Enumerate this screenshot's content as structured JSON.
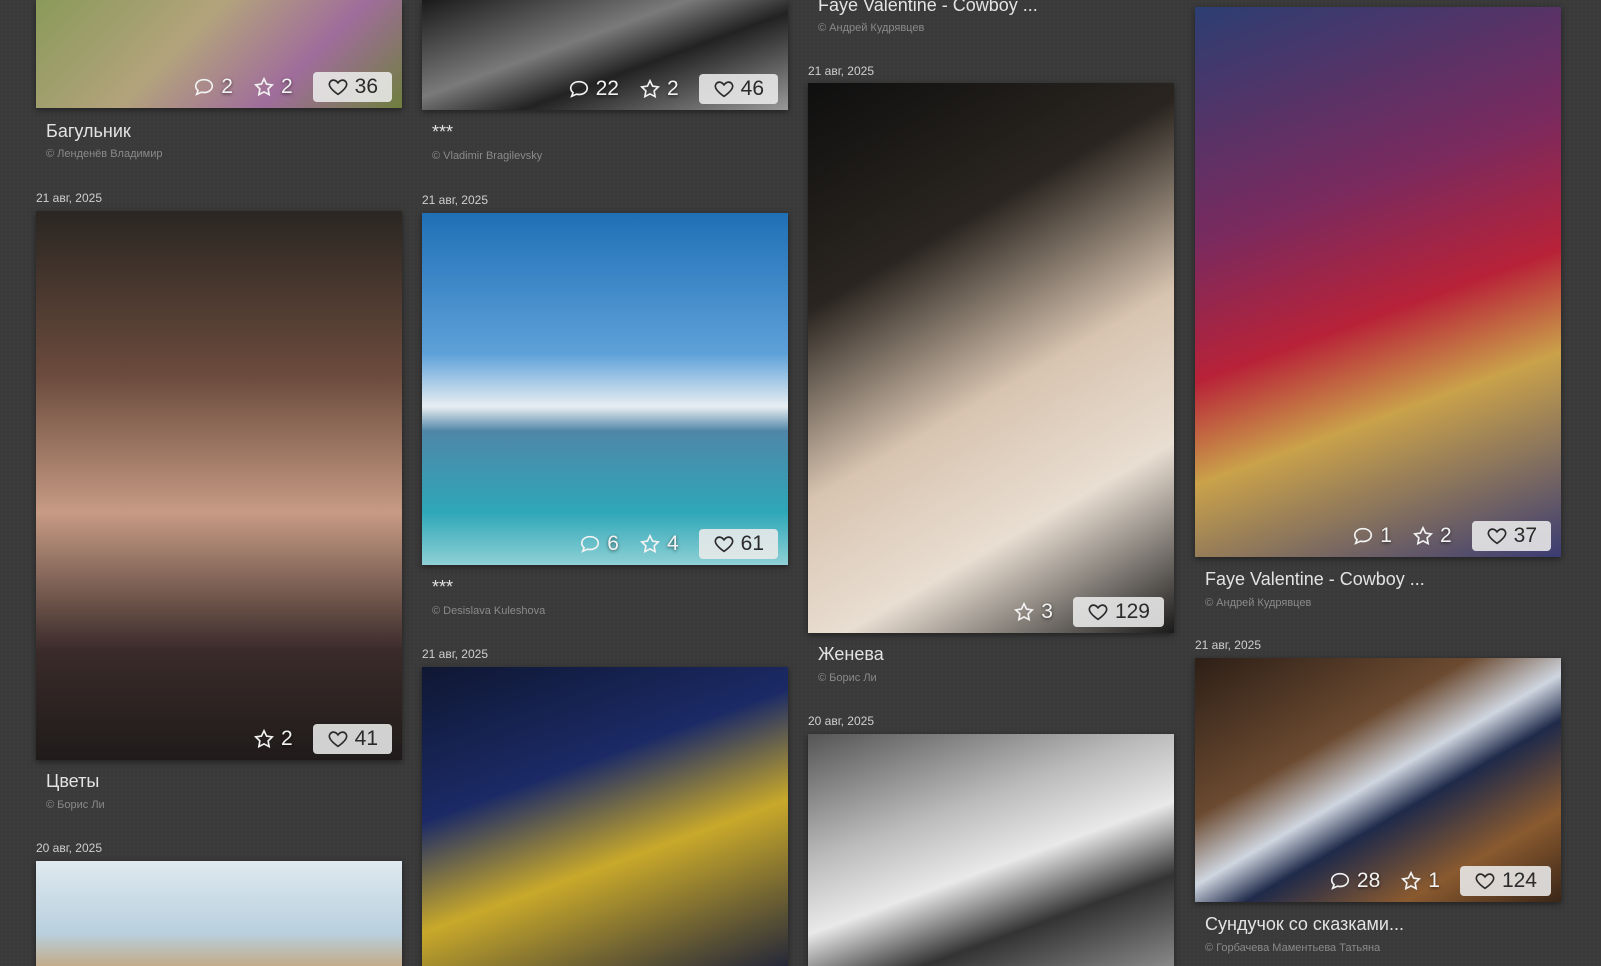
{
  "columns": [
    {
      "cards": [
        {
          "date": "",
          "title": "Багульник",
          "author": "© Ленденёв Владимир",
          "comments": "2",
          "stars": "2",
          "likes": "36"
        },
        {
          "date": "21 авг, 2025",
          "title": "Цветы",
          "author": "© Борис Ли",
          "comments": "",
          "stars": "2",
          "likes": "41"
        },
        {
          "date": "20 авг, 2025",
          "title": "",
          "author": "",
          "comments": "",
          "stars": "",
          "likes": ""
        }
      ]
    },
    {
      "cards": [
        {
          "date": "",
          "title": "***",
          "author": "© Vladimir Bragilevsky",
          "comments": "22",
          "stars": "2",
          "likes": "46"
        },
        {
          "date": "21 авг, 2025",
          "title": "***",
          "author": "© Desislava Kuleshova",
          "comments": "6",
          "stars": "4",
          "likes": "61"
        },
        {
          "date": "21 авг, 2025",
          "title": "",
          "author": "",
          "comments": "",
          "stars": "",
          "likes": ""
        }
      ]
    },
    {
      "cards": [
        {
          "date": "",
          "title": "Faye Valentine - Cowboy ...",
          "author": "© Андрей Кудрявцев",
          "comments": "",
          "stars": "",
          "likes": ""
        },
        {
          "date": "21 авг, 2025",
          "title": "Женева",
          "author": "© Борис Ли",
          "comments": "",
          "stars": "3",
          "likes": "129"
        },
        {
          "date": "20 авг, 2025",
          "title": "",
          "author": "",
          "comments": "",
          "stars": "",
          "likes": ""
        }
      ]
    },
    {
      "cards": [
        {
          "date": "",
          "title": "Faye Valentine - Cowboy ...",
          "author": "© Андрей Кудрявцев",
          "comments": "1",
          "stars": "2",
          "likes": "37"
        },
        {
          "date": "21 авг, 2025",
          "title": "Сундучок со сказками...",
          "author": "© Горбачева Маментьева Татьяна",
          "comments": "28",
          "stars": "1",
          "likes": "124"
        }
      ]
    }
  ]
}
